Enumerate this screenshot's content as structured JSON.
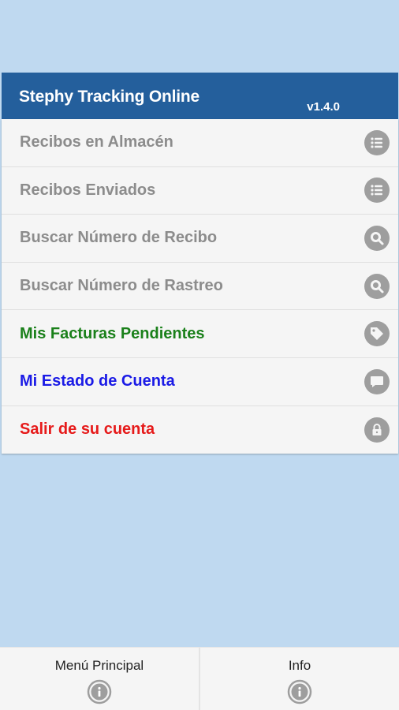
{
  "header": {
    "title": "Stephy Tracking Online",
    "version": "v1.4.0"
  },
  "menu": {
    "items": [
      {
        "label": "Recibos en Almacén",
        "icon": "list-icon",
        "color": "#8c8c8c"
      },
      {
        "label": "Recibos Enviados",
        "icon": "list-icon",
        "color": "#8c8c8c"
      },
      {
        "label": "Buscar Número de Recibo",
        "icon": "search-icon",
        "color": "#8c8c8c"
      },
      {
        "label": "Buscar Número de Rastreo",
        "icon": "search-icon",
        "color": "#8c8c8c"
      },
      {
        "label": "Mis Facturas Pendientes",
        "icon": "tag-icon",
        "color": "#1a801a"
      },
      {
        "label": "Mi Estado de Cuenta",
        "icon": "chat-bubble-icon",
        "color": "#1a1ae6"
      },
      {
        "label": "Salir de su cuenta",
        "icon": "lock-icon",
        "color": "#e61a1a"
      }
    ]
  },
  "bottom_nav": {
    "tabs": [
      {
        "label": "Menú Principal",
        "icon": "info-icon"
      },
      {
        "label": "Info",
        "icon": "info-icon"
      }
    ]
  },
  "colors": {
    "background": "#bfd9f0",
    "header": "#245f9c",
    "icon_gray": "#9e9e9e"
  }
}
